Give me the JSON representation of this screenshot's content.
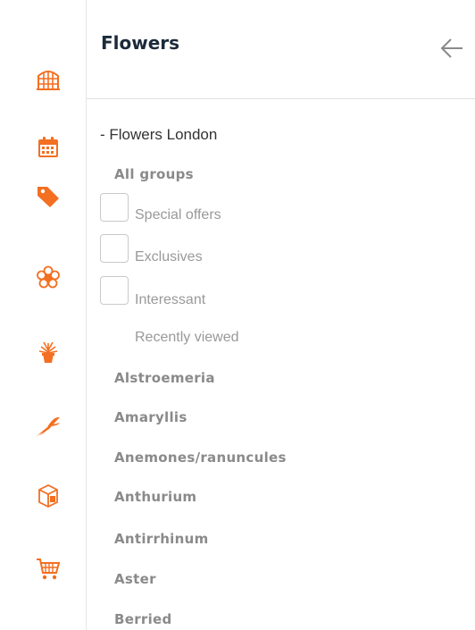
{
  "header": {
    "title": "Flowers",
    "back_icon": "arrow-left-icon"
  },
  "rail": {
    "accent": "#f36f21",
    "icons": [
      "greenhouse-icon",
      "calendar-icon",
      "tag-icon",
      "flower-icon",
      "potted-plant-icon",
      "pruning-shears-icon",
      "box-icon",
      "cart-icon"
    ]
  },
  "list": {
    "company": "- Flowers London",
    "all_groups": "All groups",
    "options": [
      {
        "label": "Special offers"
      },
      {
        "label": "Exclusives"
      },
      {
        "label": "Interessant"
      }
    ],
    "recently_viewed": "Recently viewed",
    "groups": [
      "Alstroemeria",
      "Amaryllis",
      "Anemones/ranuncules",
      "Anthurium",
      "Antirrhinum",
      "Aster",
      "Berried"
    ]
  }
}
